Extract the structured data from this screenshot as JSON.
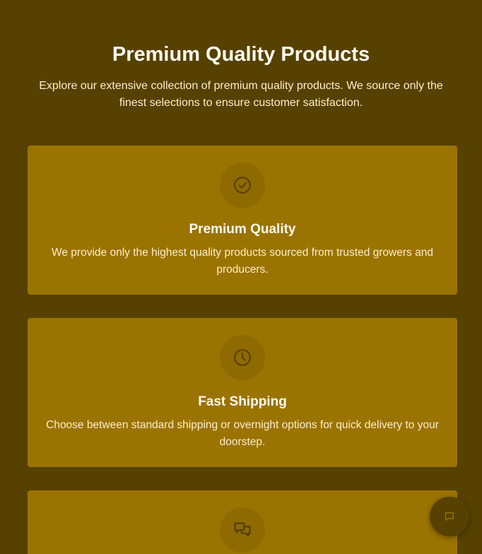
{
  "hero": {
    "title": "Premium Quality Products",
    "subtitle": "Explore our extensive collection of premium quality products. We source only the finest selections to ensure customer satisfaction."
  },
  "features": [
    {
      "icon": "check-circle-icon",
      "title": "Premium Quality",
      "description": "We provide only the highest quality products sourced from trusted growers and producers."
    },
    {
      "icon": "clock-icon",
      "title": "Fast Shipping",
      "description": "Choose between standard shipping or overnight options for quick delivery to your doorstep."
    },
    {
      "icon": "chat-bubbles-icon",
      "title": "",
      "description": ""
    }
  ],
  "chat_widget": {
    "icon": "chat-icon"
  },
  "colors": {
    "background": "#574100",
    "card": "#9b7300",
    "icon_circle": "#8e6a00",
    "icon_stroke": "#574100",
    "title_text": "#fffaf0",
    "body_text": "#fbeecc"
  }
}
